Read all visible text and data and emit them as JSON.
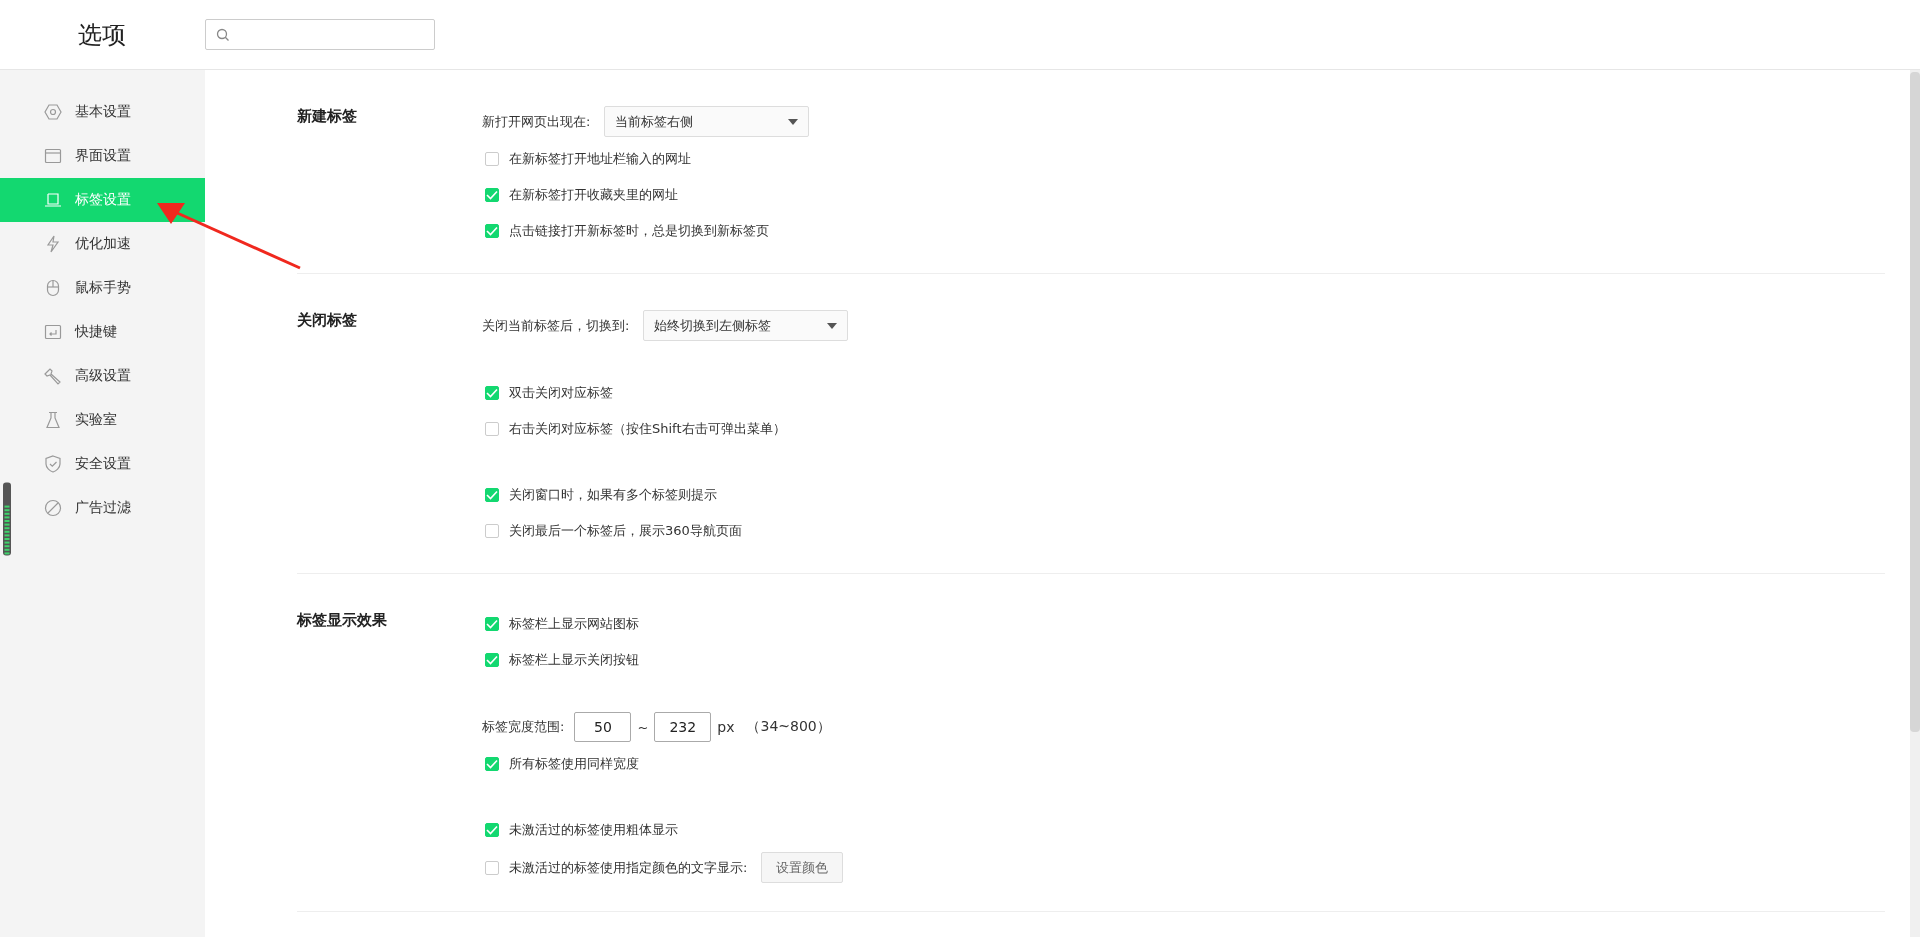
{
  "header": {
    "title": "选项"
  },
  "sidebar": {
    "items": [
      {
        "label": "基本设置",
        "selected": false
      },
      {
        "label": "界面设置",
        "selected": false
      },
      {
        "label": "标签设置",
        "selected": true
      },
      {
        "label": "优化加速",
        "selected": false
      },
      {
        "label": "鼠标手势",
        "selected": false
      },
      {
        "label": "快捷键",
        "selected": false
      },
      {
        "label": "高级设置",
        "selected": false
      },
      {
        "label": "实验室",
        "selected": false
      },
      {
        "label": "安全设置",
        "selected": false
      },
      {
        "label": "广告过滤",
        "selected": false
      }
    ]
  },
  "sections": [
    {
      "title": "新建标签",
      "groups": [
        [
          {
            "kind": "select",
            "label": "新打开网页出现在:",
            "value": "当前标签右侧"
          },
          {
            "kind": "checkbox",
            "label": "在新标签打开地址栏输入的网址",
            "checked": false
          },
          {
            "kind": "checkbox",
            "label": "在新标签打开收藏夹里的网址",
            "checked": true
          },
          {
            "kind": "checkbox",
            "label": "点击链接打开新标签时，总是切换到新标签页",
            "checked": true
          }
        ]
      ]
    },
    {
      "title": "关闭标签",
      "groups": [
        [
          {
            "kind": "select",
            "label": "关闭当前标签后，切换到:",
            "value": "始终切换到左侧标签"
          }
        ],
        [
          {
            "kind": "checkbox",
            "label": "双击关闭对应标签",
            "checked": true
          },
          {
            "kind": "checkbox",
            "label": "右击关闭对应标签（按住Shift右击可弹出菜单）",
            "checked": false
          }
        ],
        [
          {
            "kind": "checkbox",
            "label": "关闭窗口时，如果有多个标签则提示",
            "checked": true
          },
          {
            "kind": "checkbox",
            "label": "关闭最后一个标签后，展示360导航页面",
            "checked": false
          }
        ]
      ]
    },
    {
      "title": "标签显示效果",
      "groups": [
        [
          {
            "kind": "checkbox",
            "label": "标签栏上显示网站图标",
            "checked": true
          },
          {
            "kind": "checkbox",
            "label": "标签栏上显示关闭按钮",
            "checked": true
          }
        ],
        [
          {
            "kind": "range",
            "label": "标签宽度范围:",
            "min": "50",
            "separator": "~",
            "max": "232",
            "unit": "px",
            "hint": "（34~800）"
          },
          {
            "kind": "checkbox",
            "label": "所有标签使用同样宽度",
            "checked": true
          }
        ],
        [
          {
            "kind": "checkbox",
            "label": "未激活过的标签使用粗体显示",
            "checked": true
          },
          {
            "kind": "checkbox_button",
            "label": "未激活过的标签使用指定颜色的文字显示:",
            "checked": false,
            "button": "设置颜色"
          }
        ]
      ]
    }
  ]
}
